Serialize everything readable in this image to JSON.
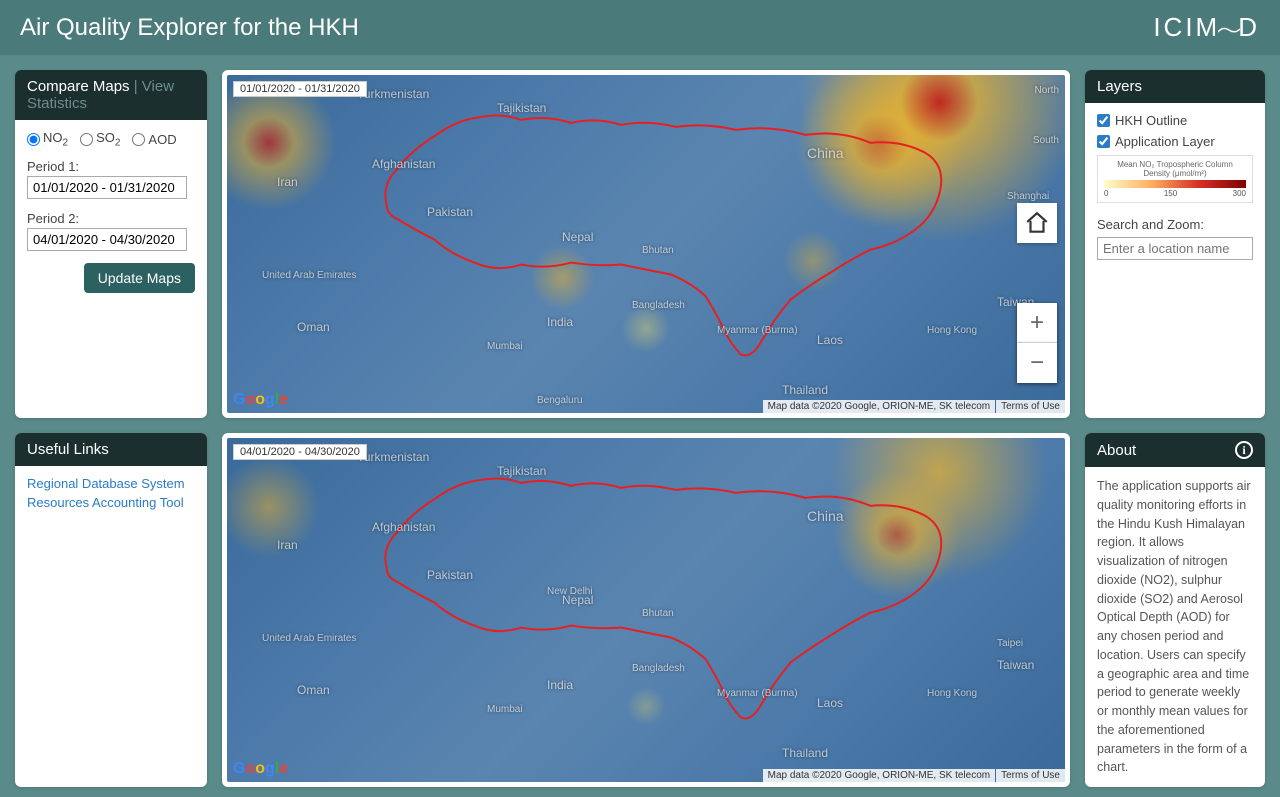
{
  "header": {
    "title": "Air Quality Explorer for the HKH",
    "logo_text": "ICIMOD"
  },
  "compare": {
    "title": "Compare Maps",
    "view_stats": "View Statistics",
    "radios": {
      "no2": "NO",
      "no2_sub": "2",
      "so2": "SO",
      "so2_sub": "2",
      "aod": "AOD",
      "selected": "no2"
    },
    "period1_label": "Period 1:",
    "period1_value": "01/01/2020 - 01/31/2020",
    "period2_label": "Period 2:",
    "period2_value": "04/01/2020 - 04/30/2020",
    "update_button": "Update Maps"
  },
  "useful_links": {
    "title": "Useful Links",
    "items": [
      "Regional Database System",
      "Resources Accounting Tool"
    ]
  },
  "layers": {
    "title": "Layers",
    "hkh_outline": "HKH Outline",
    "app_layer": "Application Layer",
    "legend_title": "Mean NO₂ Tropospheric Column Density (μmol/m²)",
    "legend_min": "0",
    "legend_mid": "150",
    "legend_max": "300",
    "search_label": "Search and Zoom:",
    "search_placeholder": "Enter a location name"
  },
  "about": {
    "title": "About",
    "body": "The application supports air quality monitoring efforts in the Hindu Kush Himalayan region. It allows visualization of nitrogen dioxide (NO2), sulphur dioxide (SO2) and Aerosol Optical Depth (AOD) for any chosen period and location. Users can specify a geographic area and time period to generate weekly or monthly mean values for the aforementioned parameters in the form of a chart."
  },
  "maps": {
    "map1_date": "01/01/2020 - 01/31/2020",
    "map2_date": "04/01/2020 - 04/30/2020",
    "attribution": "Map data ©2020 Google, ORION-ME, SK telecom",
    "terms": "Terms of Use",
    "labels": {
      "turkmenistan": "Turkmenistan",
      "afghanistan": "Afghanistan",
      "iran": "Iran",
      "pakistan": "Pakistan",
      "india": "India",
      "nepal": "Nepal",
      "china": "China",
      "bhutan": "Bhutan",
      "bangladesh": "Bangladesh",
      "myanmar": "Myanmar (Burma)",
      "laos": "Laos",
      "thailand": "Thailand",
      "taiwan": "Taiwan",
      "uae": "United Arab Emirates",
      "oman": "Oman",
      "north_korea": "North",
      "south_korea": "South",
      "tajikistan": "Tajikistan",
      "mumbai": "Mumbai",
      "bengaluru": "Bengaluru",
      "shanghai": "Shanghai",
      "hongkong": "Hong Kong",
      "taipei": "Taipei",
      "newdelhi": "New Delhi"
    }
  }
}
